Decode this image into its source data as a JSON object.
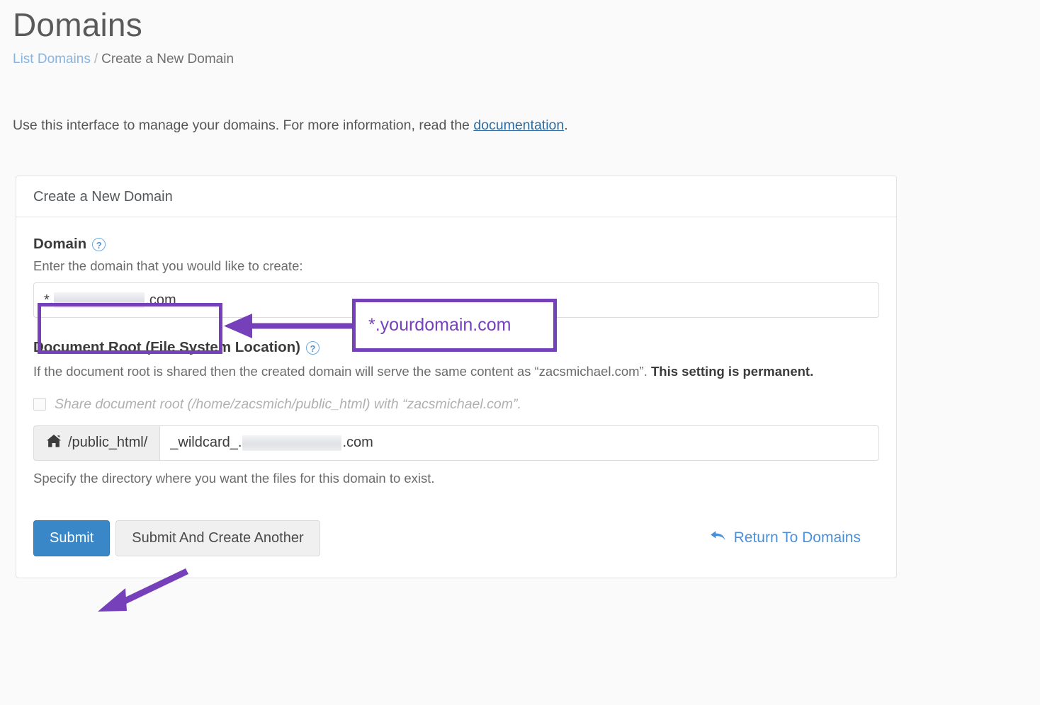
{
  "page": {
    "title": "Domains",
    "breadcrumb": {
      "link": "List Domains",
      "separator": "/",
      "current": "Create a New Domain"
    },
    "intro": {
      "before": "Use this interface to manage your domains. For more information, read the ",
      "link": "documentation",
      "after": "."
    }
  },
  "panel": {
    "heading": "Create a New Domain",
    "domain_field": {
      "label": "Domain",
      "help_icon": "question-circle-icon",
      "hint": "Enter the domain that you would like to create:",
      "value_prefix": "*.",
      "value_redacted": "[redacted domain]",
      "value_suffix": ".com"
    },
    "document_root": {
      "label": "Document Root (File System Location)",
      "help_icon": "question-circle-icon",
      "description_plain": "If the document root is shared then the created domain will serve the same content as “zacsmichael.com”. ",
      "description_bold": "This setting is permanent.",
      "share_checkbox": {
        "checked": false,
        "label": "Share document root (/home/zacsmich/public_html) with “zacsmichael.com”."
      },
      "path_addon_icon": "home-icon",
      "path_addon": "/public_html/",
      "path_value_prefix": "_wildcard_.",
      "path_value_redacted": "[redacted domain]",
      "path_value_suffix": ".com",
      "hint": "Specify the directory where you want the files for this domain to exist."
    },
    "actions": {
      "submit": "Submit",
      "submit_create_another": "Submit And Create Another",
      "return_link": "Return To Domains",
      "return_icon": "back-arrow-icon"
    }
  },
  "annotations": {
    "accent_color": "#7740bb",
    "callout_text": "*.yourdomain.com",
    "arrow_horizontal": "arrow-left-icon",
    "arrow_diagonal": "arrow-down-left-icon",
    "highlight_input": "domain-input-highlight",
    "highlight_callout": "callout-box"
  },
  "colors": {
    "primary_button": "#3a87c8",
    "link": "#4a90d9",
    "annotation": "#7740bb",
    "background": "#fafafa"
  }
}
